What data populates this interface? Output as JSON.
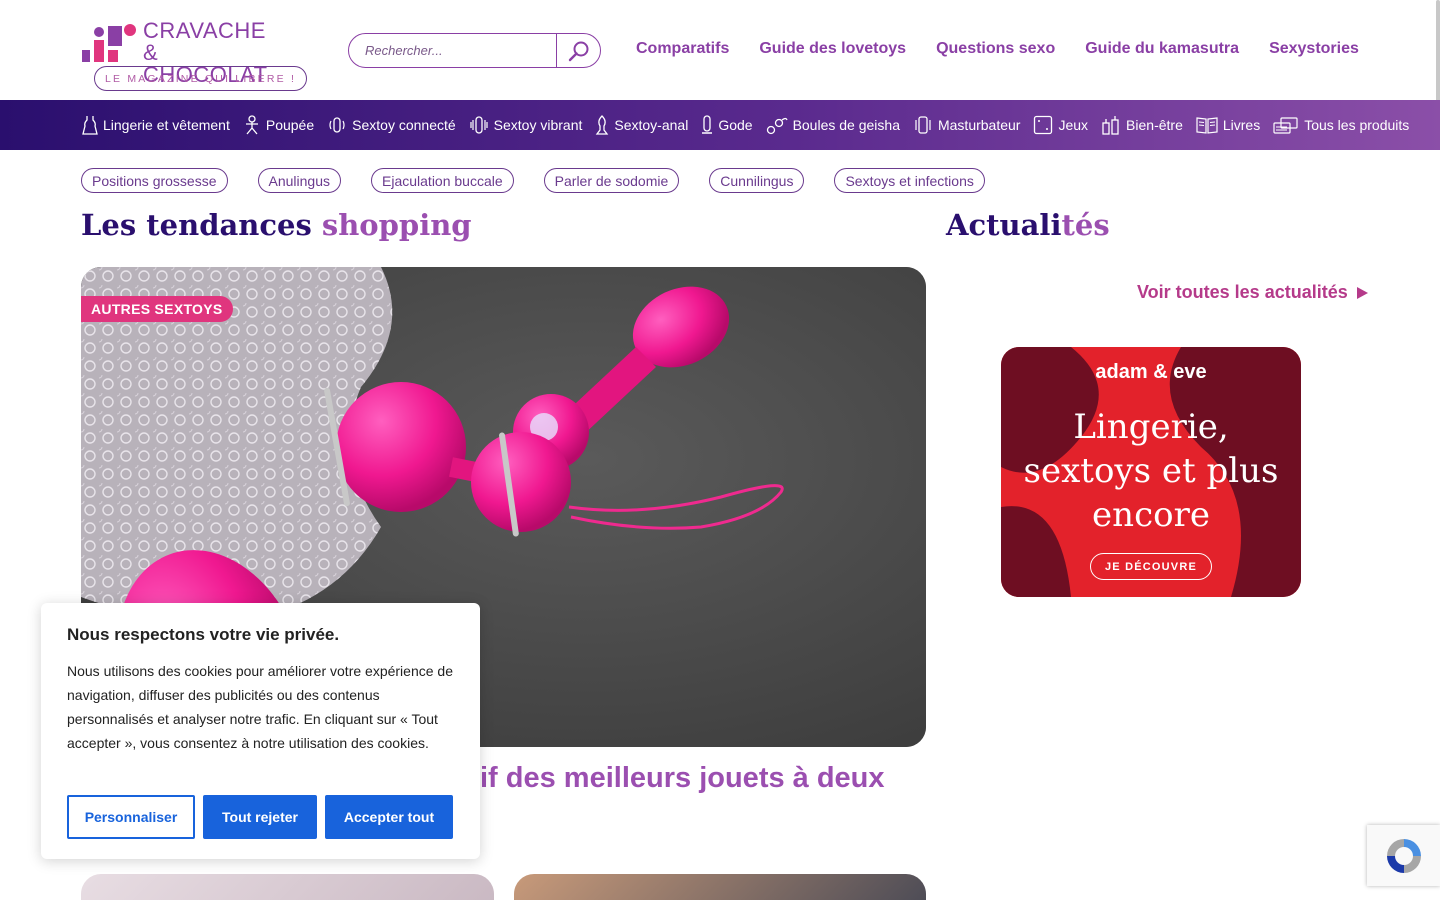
{
  "header": {
    "brand_line1": "CRAVACHE",
    "brand_line2": "& CHOCOLAT",
    "tagline": "LE MAGAZINE QUI LIBÈRE !",
    "search_placeholder": "Rechercher...",
    "nav": [
      "Comparatifs",
      "Guide des lovetoys",
      "Questions sexo",
      "Guide du kamasutra",
      "Sexystories"
    ]
  },
  "categories": [
    {
      "label": "Lingerie et vêtement",
      "icon": "lingerie-icon"
    },
    {
      "label": "Poupée",
      "icon": "doll-icon"
    },
    {
      "label": "Sextoy connecté",
      "icon": "connected-toy-icon"
    },
    {
      "label": "Sextoy vibrant",
      "icon": "vibrator-icon"
    },
    {
      "label": "Sextoy-anal",
      "icon": "anal-toy-icon"
    },
    {
      "label": "Gode",
      "icon": "dildo-icon"
    },
    {
      "label": "Boules de geisha",
      "icon": "geisha-balls-icon"
    },
    {
      "label": "Masturbateur",
      "icon": "masturbator-icon"
    },
    {
      "label": "Jeux",
      "icon": "dice-icon"
    },
    {
      "label": "Bien-être",
      "icon": "wellness-icon"
    },
    {
      "label": "Livres",
      "icon": "book-icon"
    },
    {
      "label": "Tous les produits",
      "icon": "products-icon"
    }
  ],
  "tags": [
    "Positions grossesse",
    "Anulingus",
    "Ejaculation buccale",
    "Parler de sodomie",
    "Cunnilingus",
    "Sextoys et infections"
  ],
  "trends": {
    "title_main": "Les tendances ",
    "title_accent": "shopping",
    "badge": "AUTRES SEXTOYS",
    "headline_visible": "if des meilleurs jouets à deux"
  },
  "news": {
    "title_main": "Actuali",
    "title_accent": "tés",
    "see_all": "Voir toutes les actualités"
  },
  "ad": {
    "brand": "adam & eve",
    "headline_lines": [
      "Lingerie,",
      "sextoys et plus",
      "encore"
    ],
    "cta": "JE DÉCOUVRE"
  },
  "cookie": {
    "title": "Nous respectons votre vie privée.",
    "body": "Nous utilisons des cookies pour améliorer votre expérience de navigation, diffuser des publicités ou des contenus personnalisés et analyser notre trafic. En cliquant sur « Tout accepter », vous consentez à notre utilisation des cookies.",
    "customize": "Personnaliser",
    "reject": "Tout rejeter",
    "accept": "Accepter tout"
  },
  "colors": {
    "brand_purple": "#8a3fa5",
    "dark_navy": "#2a0f6e",
    "pink": "#e0357e",
    "cookie_blue": "#1863dc",
    "ad_red": "#e3222b"
  }
}
